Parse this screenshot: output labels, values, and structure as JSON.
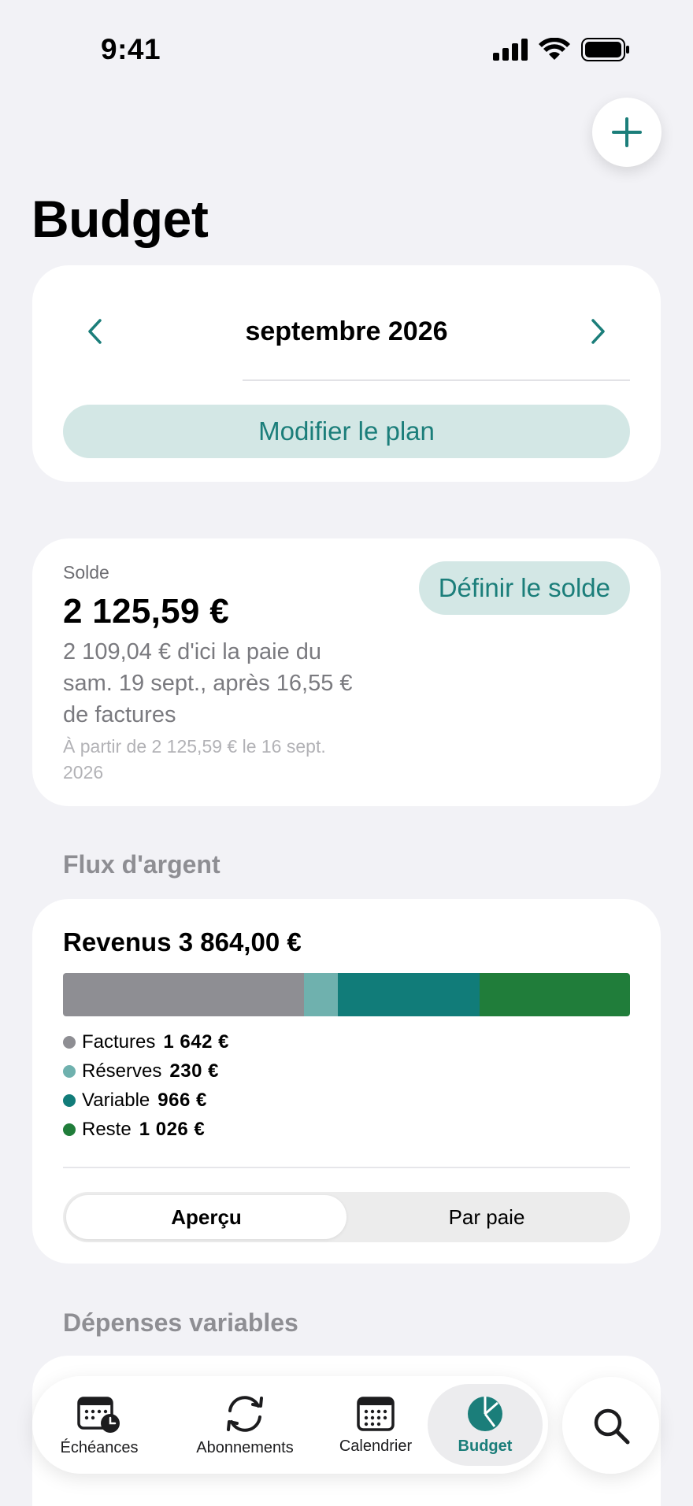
{
  "status_bar": {
    "time": "9:41"
  },
  "header": {
    "title": "Budget",
    "add_icon": "plus-icon"
  },
  "month_card": {
    "month": "septembre 2026",
    "prev_icon": "chevron-left-icon",
    "next_icon": "chevron-right-icon",
    "plan_button": "Modifier le plan"
  },
  "balance_card": {
    "label": "Solde",
    "amount": "2 125,59 €",
    "description": "2 109,04 € d'ici la paie du sam. 19 sept., après 16,55 € de factures",
    "subtext": "À partir de 2 125,59 € le 16 sept. 2026",
    "set_button": "Définir le solde"
  },
  "flux": {
    "section_title": "Flux d'argent",
    "revenue_title": "Revenus 3 864,00 €",
    "segments": [
      {
        "name": "Factures",
        "value": "1 642 €",
        "amount": 1642,
        "color": "#8e8e93"
      },
      {
        "name": "Réserves",
        "value": "230 €",
        "amount": 230,
        "color": "#6fb1ae"
      },
      {
        "name": "Variable",
        "value": "966 €",
        "amount": 966,
        "color": "#117c79"
      },
      {
        "name": "Reste",
        "value": "1 026 €",
        "amount": 1026,
        "color": "#207d3a"
      }
    ],
    "tabs": [
      "Aperçu",
      "Par paie"
    ],
    "selected_tab": "Aperçu"
  },
  "variable": {
    "section_title": "Dépenses variables"
  },
  "tab_bar": {
    "items": [
      {
        "label": "Échéances",
        "icon": "calendar-clock-icon"
      },
      {
        "label": "Abonnements",
        "icon": "refresh-icon"
      },
      {
        "label": "Calendrier",
        "icon": "calendar-icon"
      },
      {
        "label": "Budget",
        "icon": "pie-chart-icon"
      }
    ],
    "active": "Budget",
    "search_icon": "search-icon"
  },
  "colors": {
    "accent": "#1b7e7a",
    "accent_bg": "#d3e7e5",
    "background": "#f2f2f6"
  }
}
